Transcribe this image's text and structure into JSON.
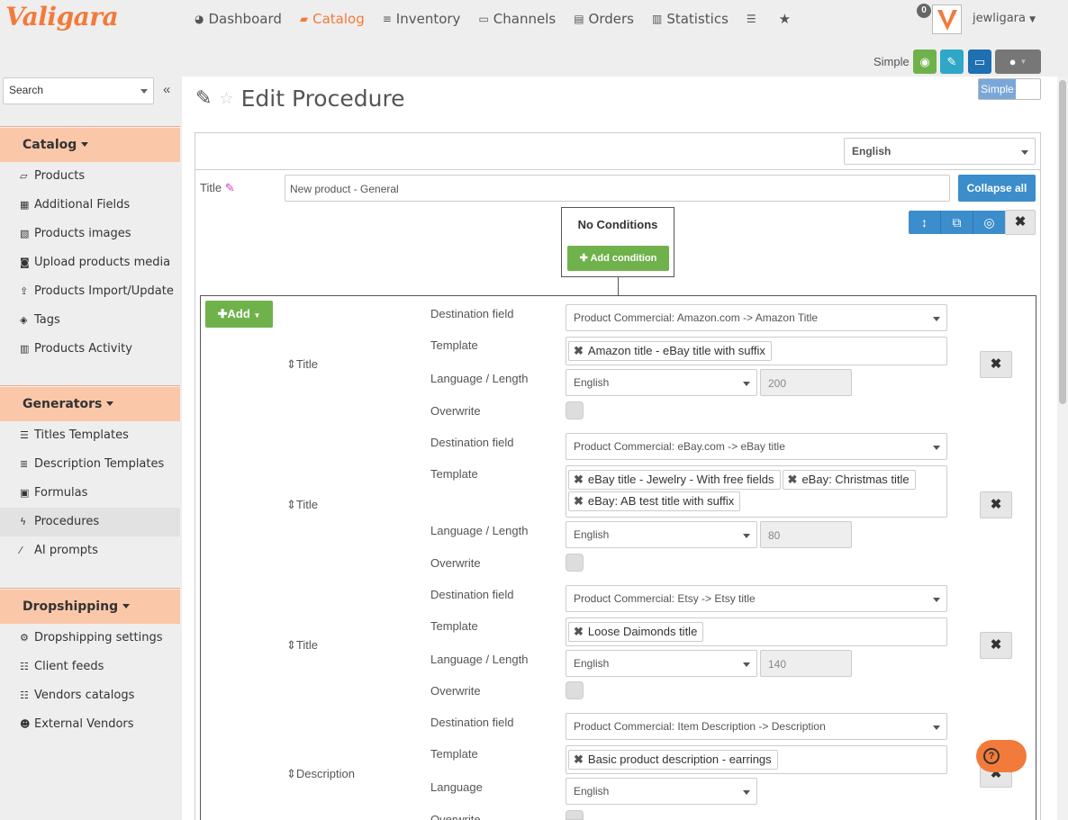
{
  "app": {
    "logo": "Valigara"
  },
  "nav": [
    {
      "label": "Dashboard",
      "icon": "dashboard-icon",
      "glyph": "◕"
    },
    {
      "label": "Catalog",
      "icon": "book-icon",
      "glyph": "▰"
    },
    {
      "label": "Inventory",
      "icon": "list-icon",
      "glyph": "≡"
    },
    {
      "label": "Channels",
      "icon": "laptop-icon",
      "glyph": "▭"
    },
    {
      "label": "Orders",
      "icon": "file-icon",
      "glyph": "▤"
    },
    {
      "label": "Statistics",
      "icon": "bar-chart-icon",
      "glyph": "▥"
    }
  ],
  "user": {
    "name": "jewligara",
    "notifications": "0"
  },
  "toolbar": {
    "mode_label": "Simple"
  },
  "sidebar": {
    "search_placeholder": "Search",
    "sections": [
      {
        "title": "Catalog",
        "items": [
          {
            "label": "Products"
          },
          {
            "label": "Additional Fields"
          },
          {
            "label": "Products images"
          },
          {
            "label": "Upload products media"
          },
          {
            "label": "Products Import/Update"
          },
          {
            "label": "Tags"
          },
          {
            "label": "Products Activity"
          }
        ]
      },
      {
        "title": "Generators",
        "items": [
          {
            "label": "Titles Templates"
          },
          {
            "label": "Description Templates"
          },
          {
            "label": "Formulas"
          },
          {
            "label": "Procedures"
          },
          {
            "label": "AI prompts"
          }
        ]
      },
      {
        "title": "Dropshipping",
        "items": [
          {
            "label": "Dropshipping settings"
          },
          {
            "label": "Client feeds"
          },
          {
            "label": "Vendors catalogs"
          },
          {
            "label": "External Vendors"
          }
        ]
      }
    ]
  },
  "page": {
    "title": "Edit Procedure",
    "toggle_label": "Simple",
    "language": "English",
    "title_label": "Title",
    "title_value": "New product - General",
    "collapse_all": "Collapse all",
    "conditions_title": "No Conditions",
    "add_condition": "Add condition",
    "add_label": "Add"
  },
  "labels": {
    "destination": "Destination field",
    "template": "Template",
    "lang_length": "Language / Length",
    "language": "Language",
    "overwrite": "Overwrite"
  },
  "rules": [
    {
      "type": "Title",
      "destination": "Product Commercial: Amazon.com -> Amazon Title",
      "templates": [
        "Amazon title - eBay title with suffix"
      ],
      "language": "English",
      "length": "200"
    },
    {
      "type": "Title",
      "destination": "Product Commercial: eBay.com -> eBay title",
      "templates": [
        "eBay title - Jewelry - With free fields",
        "eBay: Christmas title",
        "eBay: AB test title with suffix"
      ],
      "language": "English",
      "length": "80"
    },
    {
      "type": "Title",
      "destination": "Product Commercial: Etsy -> Etsy title",
      "templates": [
        "Loose Daimonds title"
      ],
      "language": "English",
      "length": "140"
    },
    {
      "type": "Description",
      "destination": "Product Commercial: Item Description -> Description",
      "templates": [
        "Basic product description - earrings"
      ],
      "language": "English"
    }
  ]
}
